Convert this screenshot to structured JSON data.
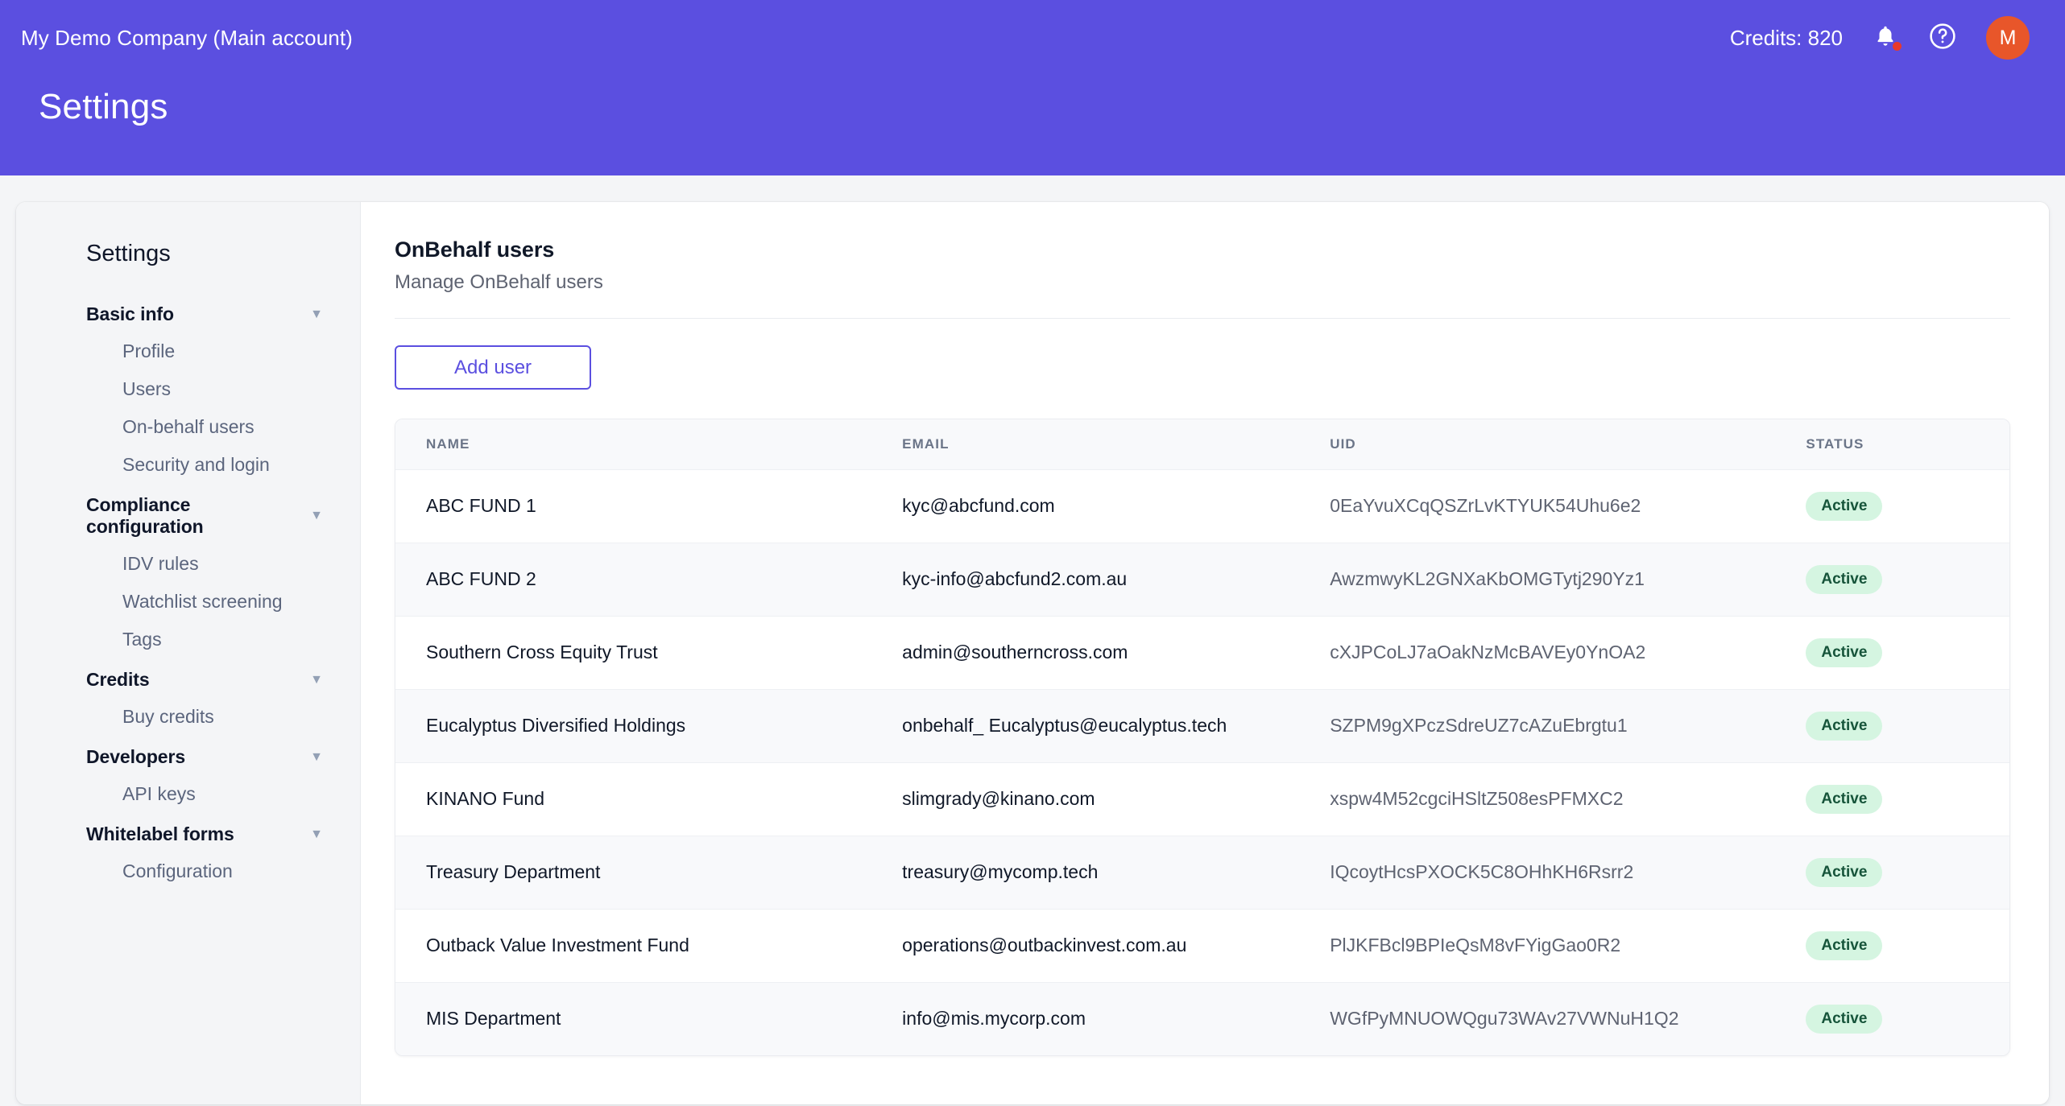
{
  "header": {
    "account_name": "My Demo Company (Main account)",
    "page_title": "Settings",
    "credits_label": "Credits: 820",
    "avatar_initial": "M",
    "brand_color": "#5b4fe0",
    "avatar_color": "#e8562a",
    "notification_dot_color": "#e8392b"
  },
  "sidebar": {
    "title": "Settings",
    "groups": [
      {
        "label": "Basic info",
        "items": [
          {
            "label": "Profile"
          },
          {
            "label": "Users"
          },
          {
            "label": "On-behalf users"
          },
          {
            "label": "Security and login"
          }
        ]
      },
      {
        "label": "Compliance configuration",
        "items": [
          {
            "label": "IDV rules"
          },
          {
            "label": "Watchlist screening"
          },
          {
            "label": "Tags"
          }
        ]
      },
      {
        "label": "Credits",
        "items": [
          {
            "label": "Buy credits"
          }
        ]
      },
      {
        "label": "Developers",
        "items": [
          {
            "label": "API keys"
          }
        ]
      },
      {
        "label": "Whitelabel forms",
        "items": [
          {
            "label": "Configuration"
          }
        ]
      }
    ]
  },
  "main": {
    "title": "OnBehalf users",
    "subtitle": "Manage OnBehalf users",
    "add_user_label": "Add user",
    "table": {
      "columns": [
        "NAME",
        "EMAIL",
        "UID",
        "STATUS"
      ],
      "rows": [
        {
          "name": "ABC FUND 1",
          "email": "kyc@abcfund.com",
          "uid": "0EaYvuXCqQSZrLvKTYUK54Uhu6e2",
          "status": "Active"
        },
        {
          "name": "ABC FUND 2",
          "email": "kyc-info@abcfund2.com.au",
          "uid": "AwzmwyKL2GNXaKbOMGTytj290Yz1",
          "status": "Active"
        },
        {
          "name": "Southern Cross Equity Trust",
          "email": "admin@southerncross.com",
          "uid": "cXJPCoLJ7aOakNzMcBAVEy0YnOA2",
          "status": "Active"
        },
        {
          "name": "Eucalyptus Diversified Holdings",
          "email": "onbehalf_ Eucalyptus@eucalyptus.tech",
          "uid": "SZPM9gXPczSdreUZ7cAZuEbrgtu1",
          "status": "Active"
        },
        {
          "name": "KINANO Fund",
          "email": "slimgrady@kinano.com",
          "uid": "xspw4M52cgciHSltZ508esPFMXC2",
          "status": "Active"
        },
        {
          "name": "Treasury Department",
          "email": "treasury@mycomp.tech",
          "uid": "IQcoytHcsPXOCK5C8OHhKH6Rsrr2",
          "status": "Active"
        },
        {
          "name": "Outback Value Investment Fund",
          "email": "operations@outbackinvest.com.au",
          "uid": "PlJKFBcl9BPIeQsM8vFYigGao0R2",
          "status": "Active"
        },
        {
          "name": "MIS Department",
          "email": "info@mis.mycorp.com",
          "uid": "WGfPyMNUOWQgu73WAv27VWNuH1Q2",
          "status": "Active"
        }
      ]
    }
  },
  "icons": {
    "caret": "▼",
    "bell": "bell-icon",
    "help": "help-circle-icon"
  }
}
